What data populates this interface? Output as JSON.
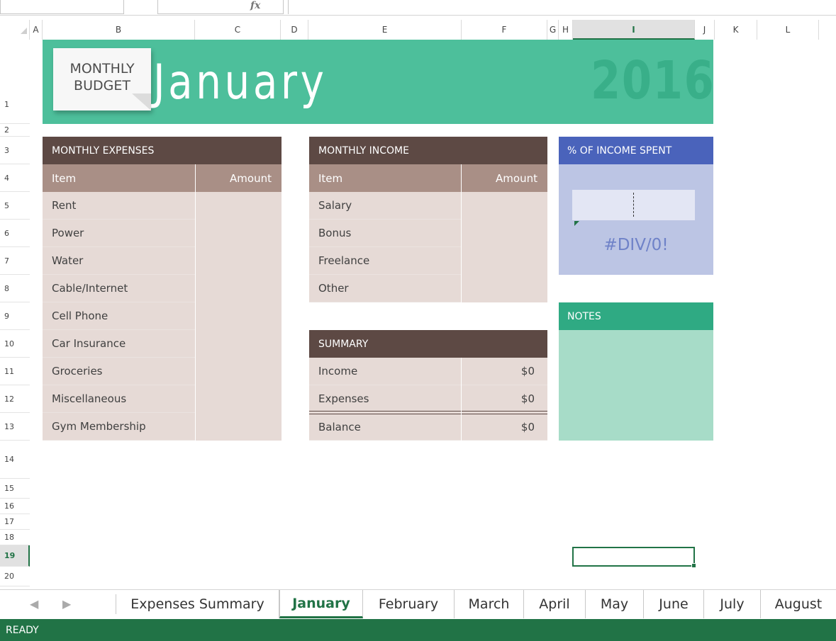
{
  "formula_bar": {
    "name_box": "",
    "fx_icon": "fx",
    "formula": ""
  },
  "columns": [
    "A",
    "B",
    "C",
    "D",
    "E",
    "F",
    "G",
    "H",
    "I",
    "J",
    "K",
    "L"
  ],
  "selected_column": "I",
  "rows": [
    "1",
    "2",
    "3",
    "4",
    "5",
    "6",
    "7",
    "8",
    "9",
    "10",
    "11",
    "12",
    "13",
    "14",
    "15",
    "16",
    "17",
    "18",
    "19",
    "20"
  ],
  "selected_row": "19",
  "banner": {
    "tag_line1": "MONTHLY",
    "tag_line2": "BUDGET",
    "month": "January",
    "year": "2016"
  },
  "expenses": {
    "title": "MONTHLY EXPENSES",
    "col_item": "Item",
    "col_amount": "Amount",
    "items": [
      "Rent",
      "Power",
      "Water",
      "Cable/Internet",
      "Cell Phone",
      "Car Insurance",
      "Groceries",
      "Miscellaneous",
      "Gym Membership"
    ]
  },
  "income": {
    "title": "MONTHLY INCOME",
    "col_item": "Item",
    "col_amount": "Amount",
    "items": [
      "Salary",
      "Bonus",
      "Freelance",
      "Other"
    ]
  },
  "summary": {
    "title": "SUMMARY",
    "rows": [
      {
        "label": "Income",
        "value": "$0"
      },
      {
        "label": "Expenses",
        "value": "$0"
      },
      {
        "label": "Balance",
        "value": "$0"
      }
    ]
  },
  "pct_spent": {
    "title": "% OF INCOME SPENT",
    "value": "#DIV/0!"
  },
  "notes": {
    "title": "NOTES"
  },
  "sheet_tabs": {
    "prev_icon": "◀",
    "next_icon": "▶",
    "tabs": [
      "Expenses Summary",
      "January",
      "February",
      "March",
      "April",
      "May",
      "June",
      "July",
      "August"
    ],
    "active": "January"
  },
  "status": {
    "text": "READY"
  },
  "colors": {
    "accent_green": "#217346",
    "banner": "#4dbf9b",
    "header_brown": "#5d4944",
    "pct_blue": "#4a63bb",
    "notes_green": "#2faa83"
  }
}
